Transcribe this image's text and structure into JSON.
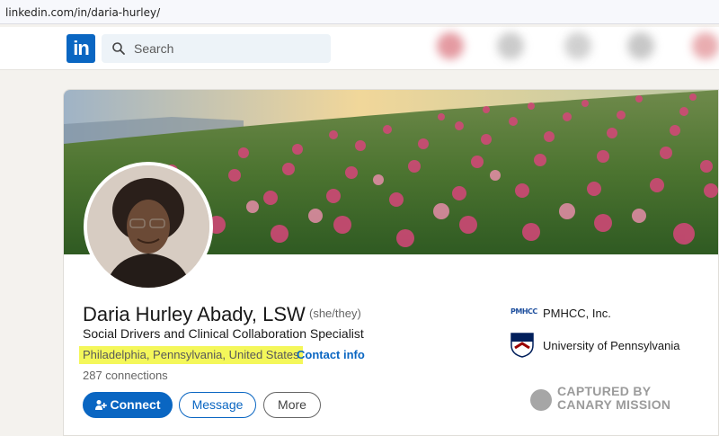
{
  "browser": {
    "url": "linkedin.com/in/daria-hurley/"
  },
  "navbar": {
    "logo_text": "in",
    "search_placeholder": "Search",
    "icons": [
      "home-icon",
      "network-icon",
      "jobs-icon",
      "messaging-icon",
      "notifications-icon"
    ]
  },
  "profile": {
    "name": "Daria Hurley Abady, LSW",
    "pronouns": "(she/they)",
    "headline": "Social Drivers and Clinical Collaboration Specialist",
    "location": "Philadelphia, Pennsylvania, United States",
    "separator": "·",
    "contact_info": "Contact info",
    "connections": "287 connections",
    "highlight_color": "#f4f75a"
  },
  "actions": {
    "connect": "Connect",
    "message": "Message",
    "more": "More"
  },
  "organizations": [
    {
      "logo_text": "PMHCC",
      "name": "PMHCC, Inc."
    },
    {
      "name": "University of Pennsylvania"
    }
  ],
  "watermark": {
    "line1": "CAPTURED BY",
    "line2": "CANARY MISSION"
  },
  "colors": {
    "accent": "#0a66c2",
    "background": "#f4f2ee"
  }
}
